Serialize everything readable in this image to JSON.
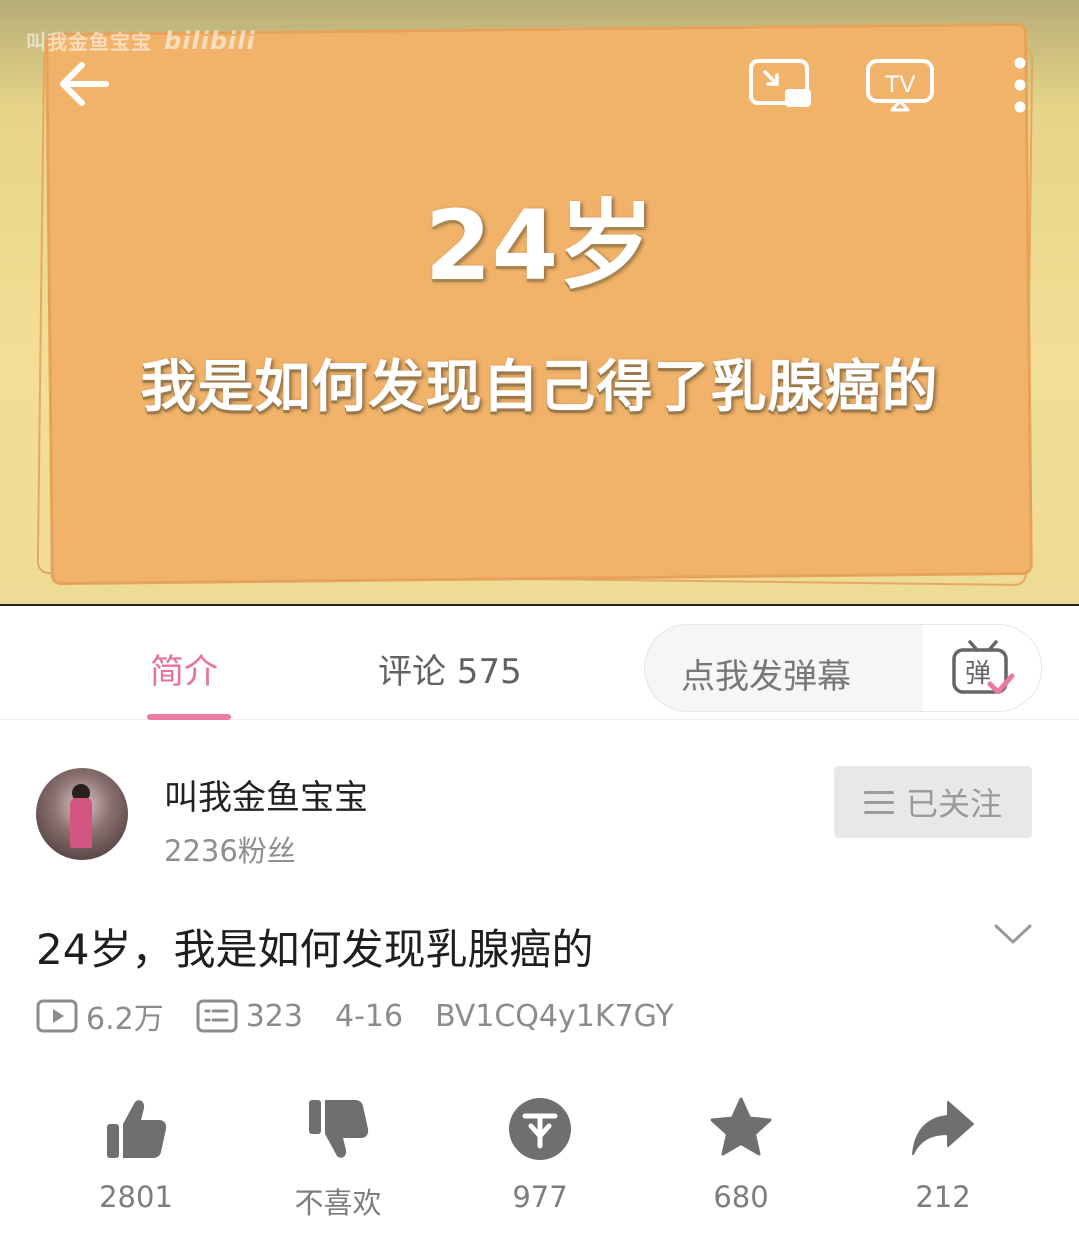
{
  "player": {
    "watermark": "叫我金鱼宝宝",
    "watermark_logo": "bilibili",
    "overlay_title": "24岁",
    "overlay_subtitle": "我是如何发现自己得了乳腺癌的",
    "icons": [
      "back-arrow-icon",
      "picture-in-picture-icon",
      "tv-cast-icon",
      "more-vertical-icon"
    ]
  },
  "tabs": {
    "intro": "简介",
    "comments": "评论 575",
    "danmaku_placeholder": "点我发弹幕",
    "danmaku_toggle_glyph": "弹"
  },
  "uploader": {
    "name": "叫我金鱼宝宝",
    "fans": "2236粉丝",
    "follow_label": "已关注"
  },
  "video": {
    "title": "24岁，我是如何发现乳腺癌的",
    "views": "6.2万",
    "danmaku_count": "323",
    "date": "4-16",
    "bvid": "BV1CQ4y1K7GY"
  },
  "actions": {
    "like": "2801",
    "dislike": "不喜欢",
    "coin": "977",
    "favorite": "680",
    "share": "212"
  },
  "colors": {
    "accent_pink": "#ea7a9f",
    "icon_gray": "#6f6f6f",
    "card_orange": "#f1b36a"
  }
}
